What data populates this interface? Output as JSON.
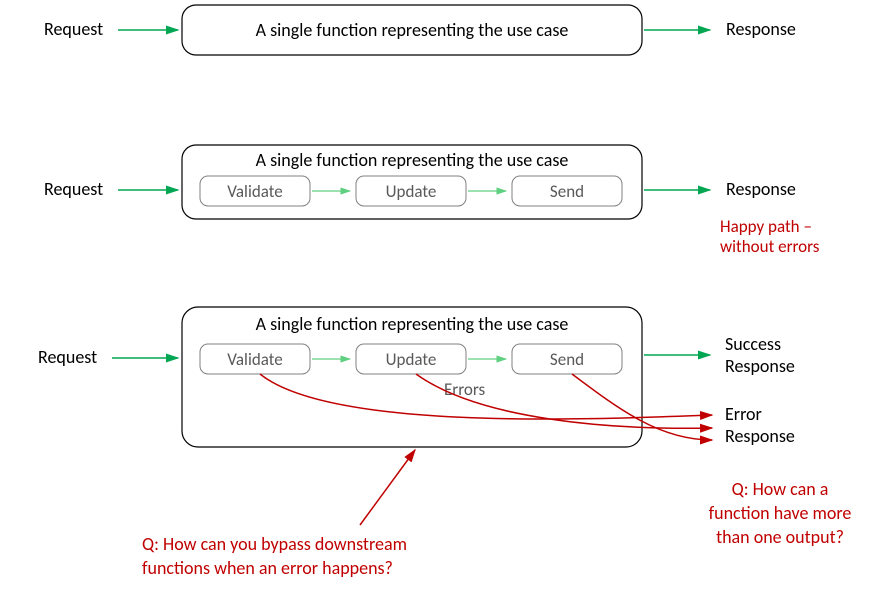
{
  "row1": {
    "request": "Request",
    "title": "A single function representing the use case",
    "response": "Response"
  },
  "row2": {
    "request": "Request",
    "title": "A single function representing the use case",
    "steps": [
      "Validate",
      "Update",
      "Send"
    ],
    "response": "Response",
    "note1": "Happy path –",
    "note2": "without errors"
  },
  "row3": {
    "request": "Request",
    "title": "A single function representing the use case",
    "steps": [
      "Validate",
      "Update",
      "Send"
    ],
    "errors_label": "Errors",
    "success": "Success",
    "response": "Response",
    "error": "Error",
    "response2": "Response"
  },
  "q1a": "Q: How can you bypass downstream",
  "q1b": "functions when an error happens?",
  "q2a": "Q: How can a",
  "q2b": "function have more",
  "q2c": "than one output?"
}
